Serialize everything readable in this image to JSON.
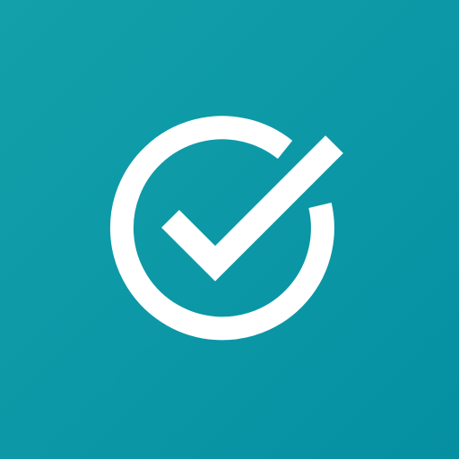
{
  "app_icon": {
    "icon": "check-circle-icon",
    "colors": {
      "background_start": "#13a0aa",
      "background_end": "#0590a2",
      "glyph": "#ffffff"
    }
  }
}
